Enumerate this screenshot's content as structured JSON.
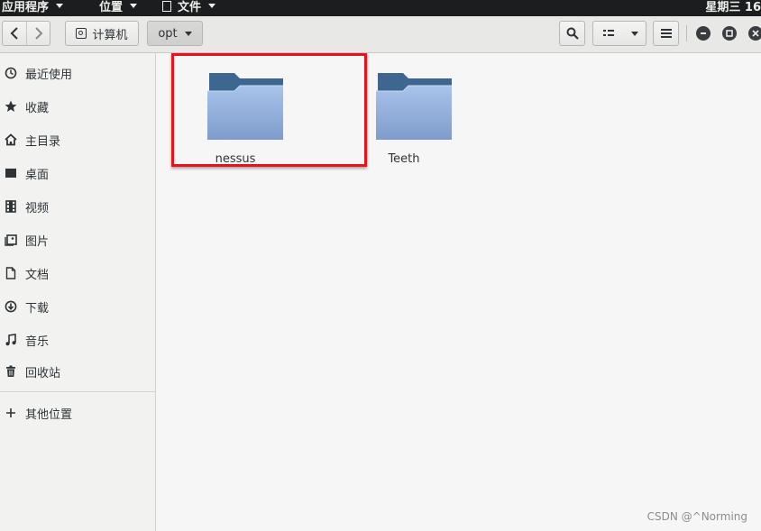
{
  "topbar": {
    "applications_label": "应用程序",
    "places_label": "位置",
    "files_label": "文件",
    "clock": "星期三 16"
  },
  "toolbar": {
    "computer_crumb": "计算机",
    "current_crumb": "opt"
  },
  "sidebar": {
    "items": [
      {
        "label": "最近使用",
        "icon": "recent-icon"
      },
      {
        "label": "收藏",
        "icon": "star-icon"
      },
      {
        "label": "主目录",
        "icon": "home-icon"
      },
      {
        "label": "桌面",
        "icon": "desktop-icon"
      },
      {
        "label": "视频",
        "icon": "video-icon"
      },
      {
        "label": "图片",
        "icon": "picture-icon"
      },
      {
        "label": "文档",
        "icon": "document-icon"
      },
      {
        "label": "下载",
        "icon": "download-icon"
      },
      {
        "label": "音乐",
        "icon": "music-icon"
      },
      {
        "label": "回收站",
        "icon": "trash-icon"
      }
    ],
    "other_locations": {
      "label": "其他位置",
      "icon": "plus-icon"
    }
  },
  "main": {
    "folders": [
      {
        "name": "nessus",
        "highlighted": true
      },
      {
        "name": "Teeth",
        "highlighted": false
      }
    ],
    "highlight_color": "#e8121a",
    "folder_color": "#8ea8d3"
  },
  "watermark": "CSDN @^Norming"
}
